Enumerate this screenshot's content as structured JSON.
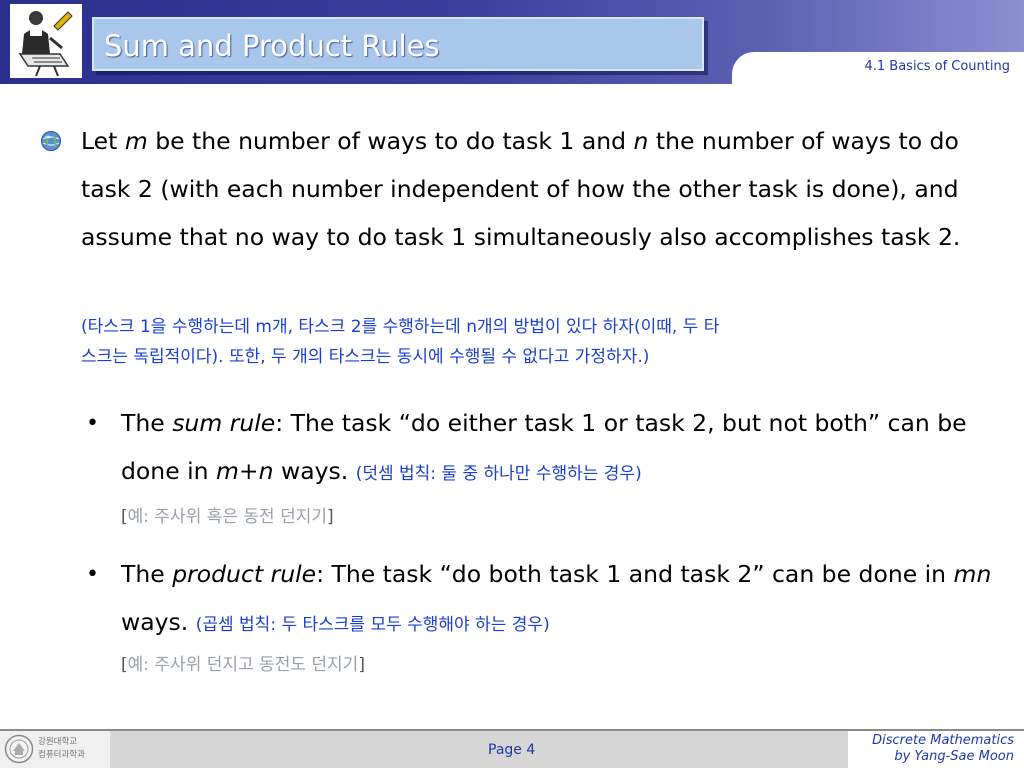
{
  "header": {
    "title": "Sum and Product Rules",
    "section": "4.1 Basics of Counting"
  },
  "main": {
    "intro": {
      "t1": "Let ",
      "m": "m",
      "t2": " be the number of ways to do task 1 and ",
      "n": "n",
      "t3": " the number of ways to do task 2 (with each number independent of how the other task is done), and assume that no way to do task 1 simultaneously also accomplishes task 2.",
      "ko_line1": "(타스크 1을 수행하는데 m개, 타스크 2를 수행하는데 n개의 방법이 있다 하자(이때, 두 타",
      "ko_line2": "스크는 독립적이다). 또한, 두 개의 타스크는 동시에 수행될 수 없다고 가정하자.)"
    },
    "sum_rule": {
      "t1": "The ",
      "term": "sum rule",
      "t2": ": The task “do either task 1 or task 2, but not both” can be done in ",
      "expr": "m+n",
      "t3": " ways. ",
      "ko": "(덧셈 법칙: 둘 중 하나만 수행하는 경우)",
      "example_open": "[",
      "example": "예: 주사위 혹은 동전 던지기",
      "example_close": "]"
    },
    "product_rule": {
      "t1": "The ",
      "term": "product rule",
      "t2": ": The task “do both task 1 and task 2” can be done in ",
      "expr": "mn",
      "t3": " ways. ",
      "ko": "(곱셈 법칙: 두 타스크를 모두 수행해야 하는 경우)",
      "example_open": "[",
      "example": "예: 주사위 던지고 동전도 던지기",
      "example_close": "]"
    }
  },
  "footer": {
    "page": "Page 4",
    "course": "Discrete Mathematics",
    "author": "by Yang-Sae Moon",
    "university_line1": "강원대학교",
    "university_line2": "컴퓨터과학과"
  },
  "colors": {
    "header_dark": "#2b2f8c",
    "title_box": "#a9c7ea",
    "korean_text": "#1a3fcf",
    "example_text": "#9aa0a8",
    "footer_text": "#1f3aa8"
  },
  "icons": {
    "logo": "reader-figure-icon",
    "bullet": "globe-bullet-icon",
    "seal": "university-seal-icon"
  }
}
